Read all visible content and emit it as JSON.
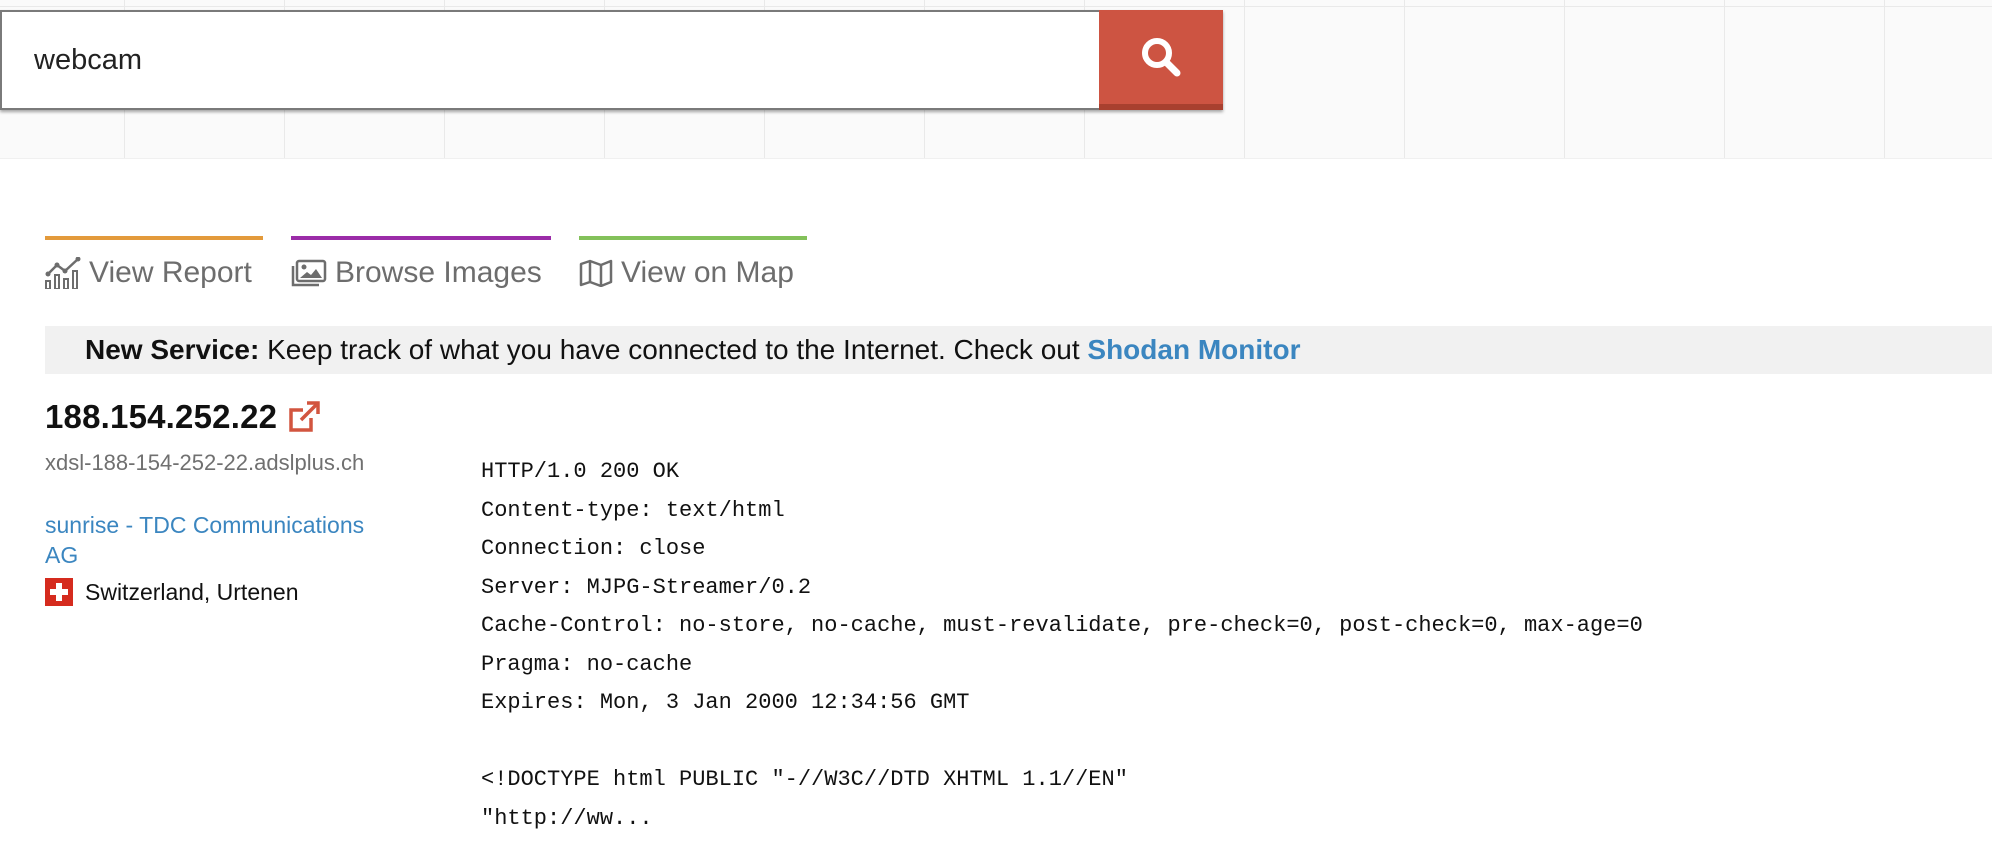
{
  "search": {
    "value": "webcam",
    "icon": "search-icon"
  },
  "actions": [
    {
      "label": "View Report",
      "icon": "chart-icon",
      "color": "#e39a3b"
    },
    {
      "label": "Browse Images",
      "icon": "images-icon",
      "color": "#9b2ca8"
    },
    {
      "label": "View on Map",
      "icon": "map-icon",
      "color": "#83c15a"
    }
  ],
  "notice": {
    "lead": "New Service:",
    "text": " Keep track of what you have connected to the Internet. Check out ",
    "link": "Shodan Monitor"
  },
  "result": {
    "ip": "188.154.252.22",
    "hostname": "xdsl-188-154-252-22.adslplus.ch",
    "org": "sunrise - TDC Communications AG",
    "location": "Switzerland, Urtenen",
    "banner_lines": [
      "HTTP/1.0 200 OK",
      "Content-type: text/html",
      "Connection: close",
      "Server: MJPG-Streamer/0.2",
      "Cache-Control: no-store, no-cache, must-revalidate, pre-check=0, post-check=0, max-age=0",
      "Pragma: no-cache",
      "Expires: Mon, 3 Jan 2000 12:34:56 GMT",
      "",
      "<!DOCTYPE html PUBLIC \"-//W3C//DTD XHTML 1.1//EN\"",
      "\"http://ww..."
    ]
  },
  "colors": {
    "accent": "#cd5442",
    "link": "#3b86c0"
  }
}
